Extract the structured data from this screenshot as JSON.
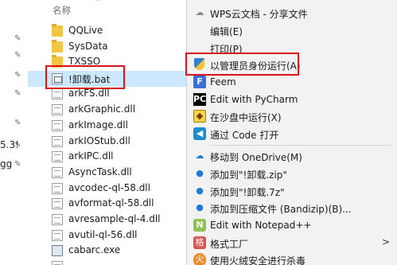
{
  "gutter": {
    "fragments": [
      "5.3!",
      "gg"
    ]
  },
  "explorer": {
    "header_label": "名称",
    "files": [
      {
        "name": "QQLive",
        "type": "folder"
      },
      {
        "name": "SysData",
        "type": "folder"
      },
      {
        "name": "TXSSO",
        "type": "folder"
      },
      {
        "name": "!卸载.bat",
        "type": "bat"
      },
      {
        "name": "arkFS.dll",
        "type": "file"
      },
      {
        "name": "arkGraphic.dll",
        "type": "file"
      },
      {
        "name": "arkImage.dll",
        "type": "file"
      },
      {
        "name": "arkIOStub.dll",
        "type": "file"
      },
      {
        "name": "arkIPC.dll",
        "type": "file"
      },
      {
        "name": "AsyncTask.dll",
        "type": "file"
      },
      {
        "name": "avcodec-ql-58.dll",
        "type": "file"
      },
      {
        "name": "avformat-ql-58.dll",
        "type": "file"
      },
      {
        "name": "avresample-ql-4.dll",
        "type": "file"
      },
      {
        "name": "avutil-ql-56.dll",
        "type": "file"
      },
      {
        "name": "cabarc.exe",
        "type": "exe"
      }
    ]
  },
  "context_menu": {
    "items": [
      {
        "label": "WPS云文档 - 分享文件",
        "icon": "wps-cloud-icon"
      },
      {
        "label": "编辑(E)",
        "icon": ""
      },
      {
        "label": "打印(P)",
        "icon": ""
      },
      {
        "label": "以管理员身份运行(A)",
        "icon": "uac-shield-icon"
      },
      {
        "label": "Feem",
        "icon": "feem-icon"
      },
      {
        "label": "Edit with PyCharm",
        "icon": "pycharm-icon"
      },
      {
        "label": "在沙盘中运行(X)",
        "icon": "sandbox-icon"
      },
      {
        "label": "通过 Code 打开",
        "icon": "vscode-icon"
      },
      {
        "label": "移动到 OneDrive(M)",
        "icon": "onedrive-icon"
      },
      {
        "label": "添加到\"!卸载.zip\"",
        "icon": "bandizip-icon"
      },
      {
        "label": "添加到\"!卸载.7z\"",
        "icon": "bandizip-icon"
      },
      {
        "label": "添加到压缩文件 (Bandizip)(B)...",
        "icon": "bandizip-icon"
      },
      {
        "label": "Edit with Notepad++",
        "icon": "notepadpp-icon"
      },
      {
        "label": "格式工厂",
        "icon": "format-factory-icon"
      },
      {
        "label": "使用火绒安全进行杀毒",
        "icon": "huorong-icon"
      }
    ],
    "submenu_arrow": ">"
  },
  "colors": {
    "highlight_box": "#d8131b",
    "selection": "#cce8ff",
    "menu_bg": "#f2f2f2"
  }
}
